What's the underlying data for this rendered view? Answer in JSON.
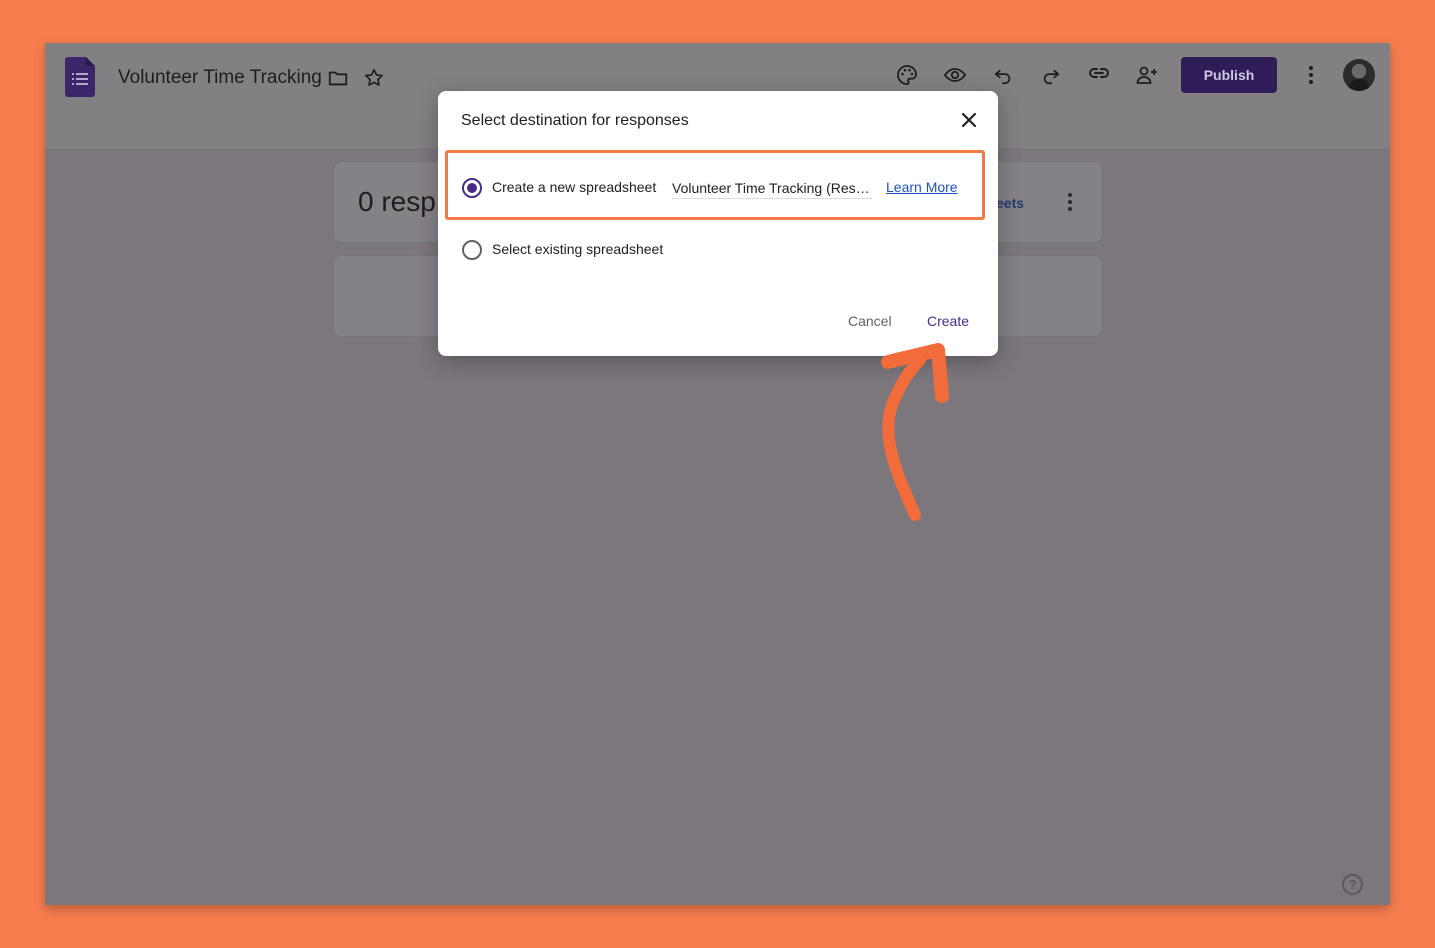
{
  "header": {
    "doc_title": "Volunteer Time Tracking",
    "publish_label": "Publish"
  },
  "icons": {
    "forms_logo": "forms-logo-icon",
    "folder": "folder-icon",
    "star": "star-icon",
    "palette": "palette-icon",
    "preview": "eye-icon",
    "undo": "undo-icon",
    "redo": "redo-icon",
    "link": "link-icon",
    "add_collaborator": "person-add-icon",
    "more": "more-vert-icon",
    "help": "help-icon"
  },
  "responses": {
    "count_label": "0 resp",
    "sheets_link_partial": "eets"
  },
  "dialog": {
    "title": "Select destination for responses",
    "option_new": "Create a new spreadsheet",
    "new_sheet_name": "Volunteer Time Tracking (Responses)",
    "learn_more": "Learn More",
    "option_existing": "Select existing spreadsheet",
    "cancel": "Cancel",
    "create": "Create",
    "selected_option": "new"
  },
  "colors": {
    "background": "#F77D4E",
    "accent": "#4A2B8C",
    "annotation": "#F26B3A",
    "link": "#1A55C4"
  }
}
